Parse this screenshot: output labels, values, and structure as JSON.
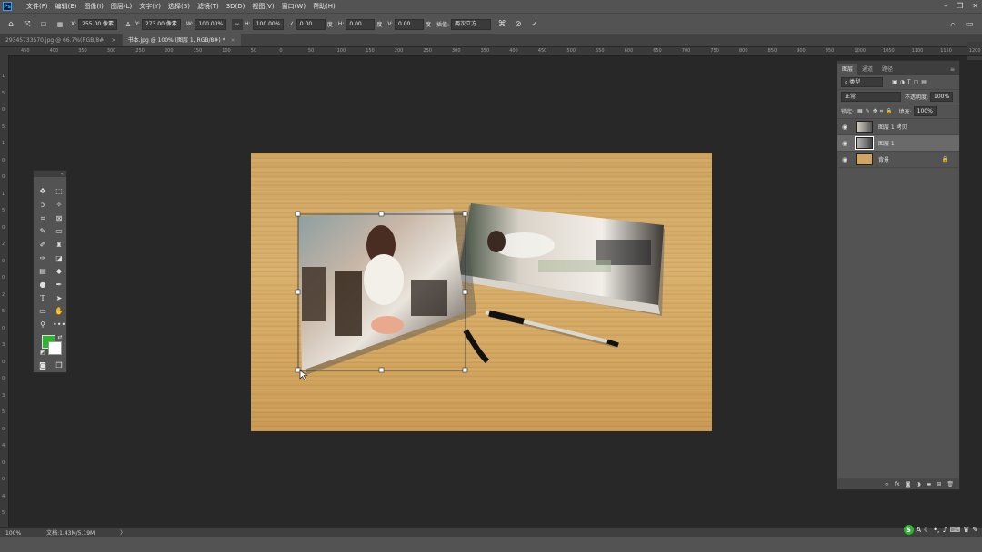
{
  "app": {
    "logo": "Ps"
  },
  "menu": [
    "文件(F)",
    "编辑(E)",
    "图像(I)",
    "图层(L)",
    "文字(Y)",
    "选择(S)",
    "滤镜(T)",
    "3D(D)",
    "视图(V)",
    "窗口(W)",
    "帮助(H)"
  ],
  "options": {
    "x_label": "X:",
    "x_value": "255.00 像素",
    "y_label": "Y:",
    "y_value": "273.00 像素",
    "w_label": "W:",
    "w_value": "100.00%",
    "h_label": "H:",
    "h_value": "100.00%",
    "angle_value": "0.00",
    "hskew_label": "H:",
    "hskew_value": "0.00",
    "vskew_label": "V:",
    "vskew_value": "0.00",
    "deg": "度",
    "interp_label": "插值:",
    "interp_value": "两次立方"
  },
  "tabs": [
    {
      "label": "29345733570.jpg @ 66.7%(RGB/8#)",
      "active": false
    },
    {
      "label": "书本.jpg @ 100% (图层 1, RGB/8#) *",
      "active": true
    }
  ],
  "ruler": {
    "h_ticks": [
      "450",
      "400",
      "350",
      "300",
      "250",
      "200",
      "150",
      "100",
      "50",
      "0",
      "50",
      "100",
      "150",
      "200",
      "250",
      "300",
      "350",
      "400",
      "450",
      "500",
      "550",
      "600",
      "650",
      "700",
      "750",
      "800",
      "850",
      "900",
      "950",
      "1000",
      "1050",
      "1100",
      "1150",
      "1200"
    ],
    "v_ticks": [
      "1",
      "5",
      "0",
      "5",
      "1",
      "0",
      "0",
      "1",
      "5",
      "0",
      "2",
      "0",
      "0",
      "2",
      "5",
      "0",
      "3",
      "0",
      "0",
      "3",
      "5",
      "0",
      "4",
      "0",
      "0",
      "4",
      "5"
    ]
  },
  "colors": {
    "foreground": "#2db52d",
    "background": "#ffffff"
  },
  "panel": {
    "tabs": [
      "图层",
      "通道",
      "路径"
    ],
    "kind_placeholder": "类型",
    "blend_mode": "正常",
    "opacity_label": "不透明度:",
    "opacity_value": "100%",
    "lock_label": "锁定:",
    "fill_label": "填充:",
    "fill_value": "100%",
    "layers": [
      {
        "name": "图层 1 拷贝",
        "selected": false
      },
      {
        "name": "图层 1",
        "selected": true
      },
      {
        "name": "背景",
        "selected": false
      }
    ]
  },
  "status": {
    "zoom": "100%",
    "doc": "文档:1.43M/5.19M",
    "arrow": "〉"
  }
}
